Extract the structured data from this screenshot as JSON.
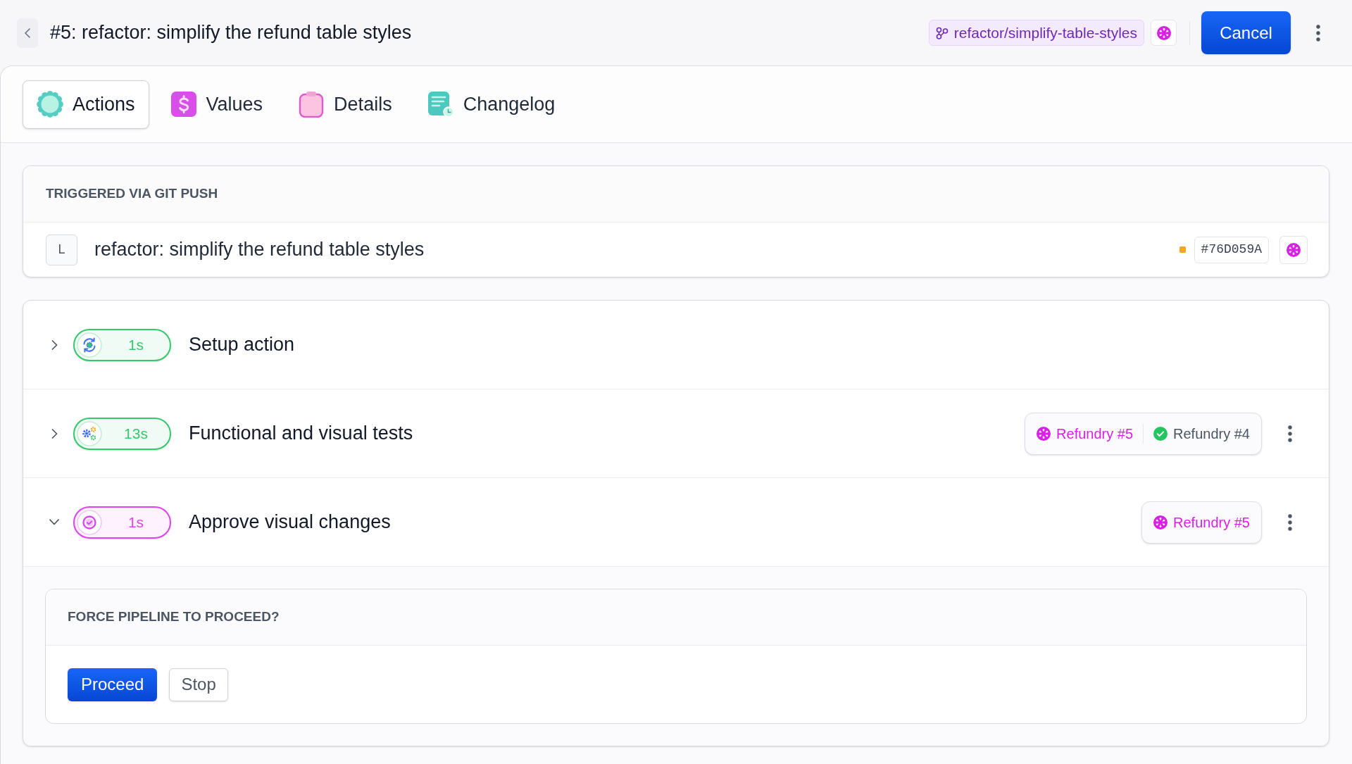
{
  "header": {
    "title": "#5: refactor: simplify the refund table styles",
    "branch": "refactor/simplify-table-styles",
    "cancel_label": "Cancel"
  },
  "tabs": [
    {
      "label": "Actions",
      "kind": "actions",
      "selected": true
    },
    {
      "label": "Values",
      "kind": "values",
      "selected": false
    },
    {
      "label": "Details",
      "kind": "details",
      "selected": false
    },
    {
      "label": "Changelog",
      "kind": "changelog",
      "selected": false
    }
  ],
  "trigger": {
    "heading": "TRIGGERED VIA GIT PUSH",
    "author_initial": "L",
    "message": "refactor: simplify the refund table styles",
    "commit_hash": "#76D059A"
  },
  "steps": [
    {
      "name": "Setup action",
      "duration": "1s",
      "kind": "setup",
      "color": "#34c96b",
      "expanded": false
    },
    {
      "name": "Functional and visual tests",
      "duration": "13s",
      "kind": "tests",
      "color": "#34c96b",
      "expanded": false,
      "runs": [
        {
          "label": "Refundry #5",
          "kind": "pending"
        },
        {
          "label": "Refundry #4",
          "kind": "passed"
        }
      ]
    },
    {
      "name": "Approve visual changes",
      "duration": "1s",
      "kind": "approval",
      "color": "#dc45ea",
      "expanded": true,
      "runs": [
        {
          "label": "Refundry #5",
          "kind": "pending"
        }
      ],
      "prompt": {
        "heading": "FORCE PIPELINE TO PROCEED?",
        "buttons": [
          {
            "label": "Proceed",
            "kind": "primary"
          },
          {
            "label": "Stop",
            "kind": "secondary"
          }
        ]
      }
    }
  ]
}
